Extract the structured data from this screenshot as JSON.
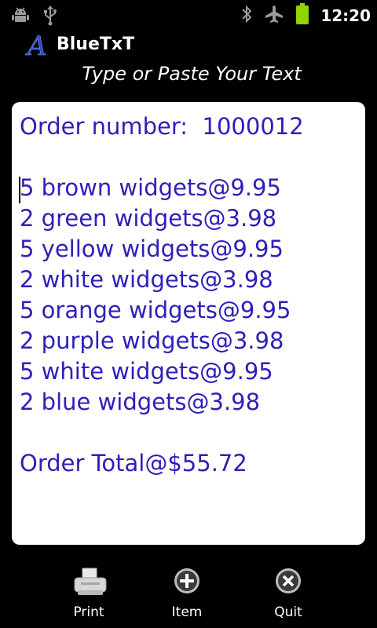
{
  "status_bar": {
    "time": "12:20",
    "icons": [
      "android-debug-icon",
      "usb-icon",
      "bluetooth-icon",
      "airplane-mode-icon",
      "battery-icon"
    ]
  },
  "app": {
    "title": "BlueTxT",
    "logo_letter": "A",
    "subtitle": "Type or Paste Your Text"
  },
  "document": {
    "text_color": "#2e20b8",
    "lines": [
      "Order number:  1000012",
      "",
      "5 brown widgets@9.95",
      "2 green widgets@3.98",
      "5 yellow widgets@9.95",
      "2 white widgets@3.98",
      "5 orange widgets@9.95",
      "2 purple widgets@3.98",
      "5 white widgets@9.95",
      "2 blue widgets@3.98",
      "",
      "Order Total@$55.72"
    ]
  },
  "menu": {
    "print_label": "Print",
    "item_label": "Item",
    "quit_label": "Quit"
  }
}
